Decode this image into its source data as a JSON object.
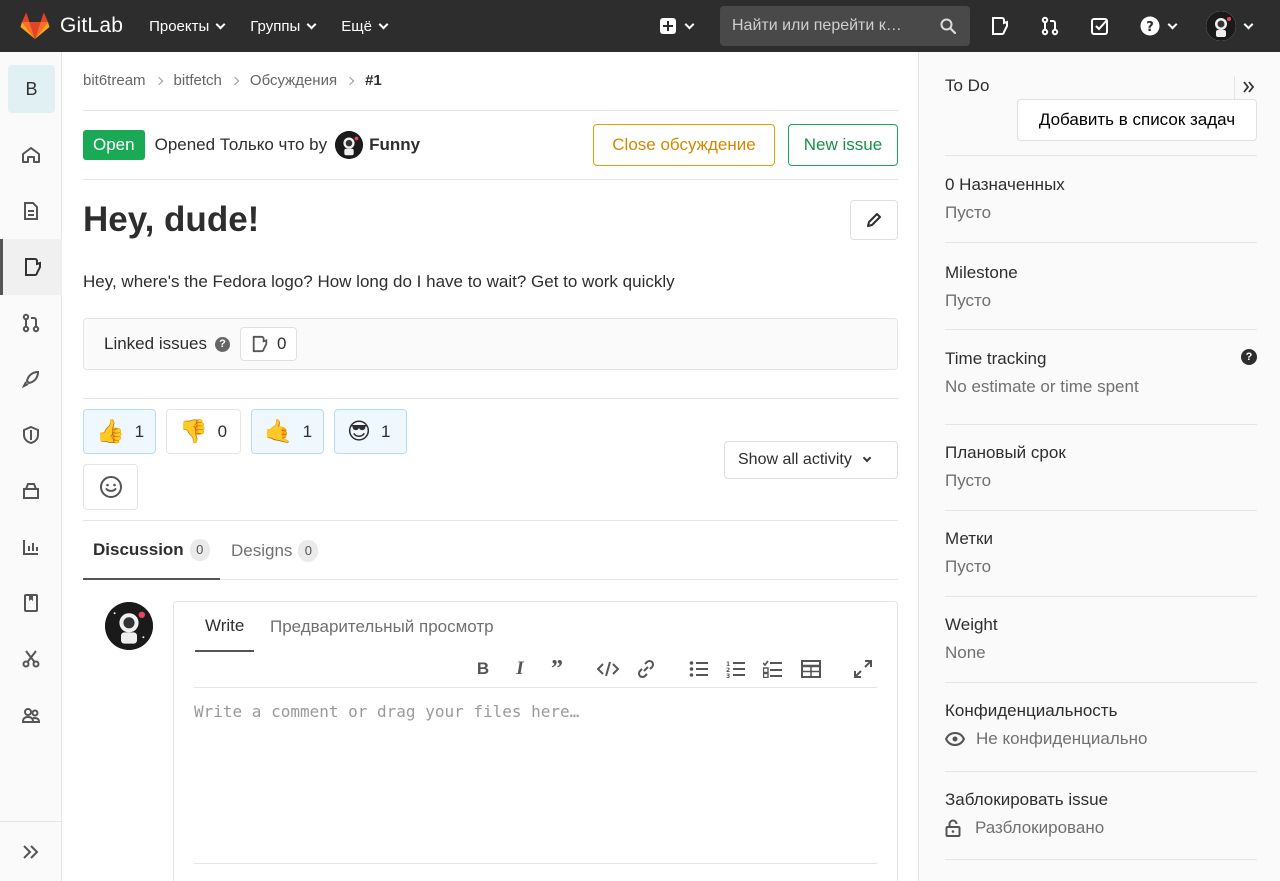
{
  "header": {
    "brand": "GitLab",
    "nav": [
      "Проекты",
      "Группы",
      "Ещё"
    ],
    "search_placeholder": "Найти или перейти к…"
  },
  "sidebar": {
    "project_letter": "B"
  },
  "breadcrumb": [
    "bit6tream",
    "bitfetch",
    "Обсуждения",
    "#1"
  ],
  "issue": {
    "status": "Open",
    "opened_text": "Opened Только что by",
    "author": "Funny",
    "close_label": "Close обсуждение",
    "new_issue_label": "New issue",
    "title": "Hey, dude!",
    "description": "Hey, where's the Fedora logo? How long do I have to wait? Get to work quickly",
    "linked_label": "Linked issues",
    "linked_count": "0"
  },
  "reactions": [
    {
      "emoji": "👍",
      "count": "1",
      "selected": true
    },
    {
      "emoji": "👎",
      "count": "0",
      "selected": false
    },
    {
      "emoji": "🤙",
      "count": "1",
      "selected": true
    },
    {
      "emoji": "😎",
      "count": "1",
      "selected": true
    }
  ],
  "activity_filter": "Show all activity",
  "tabs": [
    {
      "label": "Discussion",
      "count": "0"
    },
    {
      "label": "Designs",
      "count": "0"
    }
  ],
  "editor": {
    "write_tab": "Write",
    "preview_tab": "Предварительный просмотр",
    "placeholder": "Write a comment or drag your files here…"
  },
  "right": {
    "todo_title": "To Do",
    "todo_button": "Добавить в список задач",
    "assignees_title": "0 Назначенных",
    "assignees_value": "Пусто",
    "milestone_title": "Milestone",
    "milestone_value": "Пусто",
    "time_title": "Time tracking",
    "time_value": "No estimate or time spent",
    "due_title": "Плановый срок",
    "due_value": "Пусто",
    "labels_title": "Метки",
    "labels_value": "Пусто",
    "weight_title": "Weight",
    "weight_value": "None",
    "conf_title": "Конфиденциальность",
    "conf_value": "Не конфиденциально",
    "lock_title": "Заблокировать issue",
    "lock_value": "Разблокировано"
  }
}
